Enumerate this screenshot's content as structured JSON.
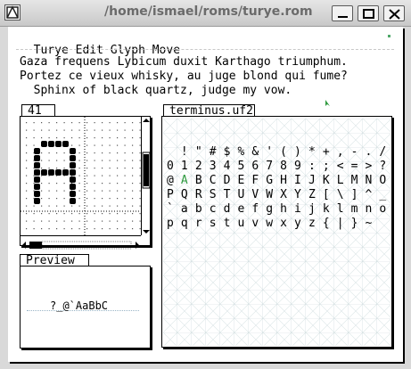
{
  "window": {
    "title": "/home/ismael/roms/turye.rom",
    "controls": [
      "minimize",
      "maximize",
      "close"
    ]
  },
  "menu": {
    "items": [
      {
        "label": "Turye"
      },
      {
        "label": "Edit"
      },
      {
        "label": "Glyph"
      },
      {
        "label": "Move"
      }
    ]
  },
  "pangrams": [
    "Gaza frequens Lybicum duxit Karthago triumphum.",
    "Portez ce vieux whisky, au juge blond qui fume?",
    "  Sphinx of black quartz, judge my vow."
  ],
  "glyph_editor": {
    "tab_label": "41"
  },
  "font_view": {
    "tab_label": "terminus.uf2",
    "rows": [
      [
        " ",
        "!",
        "\"",
        "#",
        "$",
        "%",
        "&",
        "'",
        "(",
        ")",
        "*",
        "+",
        ",",
        "-",
        ".",
        "/"
      ],
      [
        "0",
        "1",
        "2",
        "3",
        "4",
        "5",
        "6",
        "7",
        "8",
        "9",
        ":",
        ";",
        "<",
        "=",
        ">",
        "?"
      ],
      [
        "@",
        "A",
        "B",
        "C",
        "D",
        "E",
        "F",
        "G",
        "H",
        "I",
        "J",
        "K",
        "L",
        "M",
        "N",
        "O"
      ],
      [
        "P",
        "Q",
        "R",
        "S",
        "T",
        "U",
        "V",
        "W",
        "X",
        "Y",
        "Z",
        "[",
        "\\",
        "]",
        "^",
        "_"
      ],
      [
        "`",
        "a",
        "b",
        "c",
        "d",
        "e",
        "f",
        "g",
        "h",
        "i",
        "j",
        "k",
        "l",
        "m",
        "n",
        "o"
      ],
      [
        "p",
        "q",
        "r",
        "s",
        "t",
        "u",
        "v",
        "w",
        "x",
        "y",
        "z",
        "{",
        "|",
        "}",
        "~",
        ""
      ]
    ],
    "selected": "A"
  },
  "preview": {
    "tab_label": "Preview",
    "text": "?_@`AaBbC"
  },
  "colors": {
    "selected_glyph": "#2f9a3f",
    "grid_line": "#c9d6d9",
    "baseline": "#9ab5c6"
  }
}
